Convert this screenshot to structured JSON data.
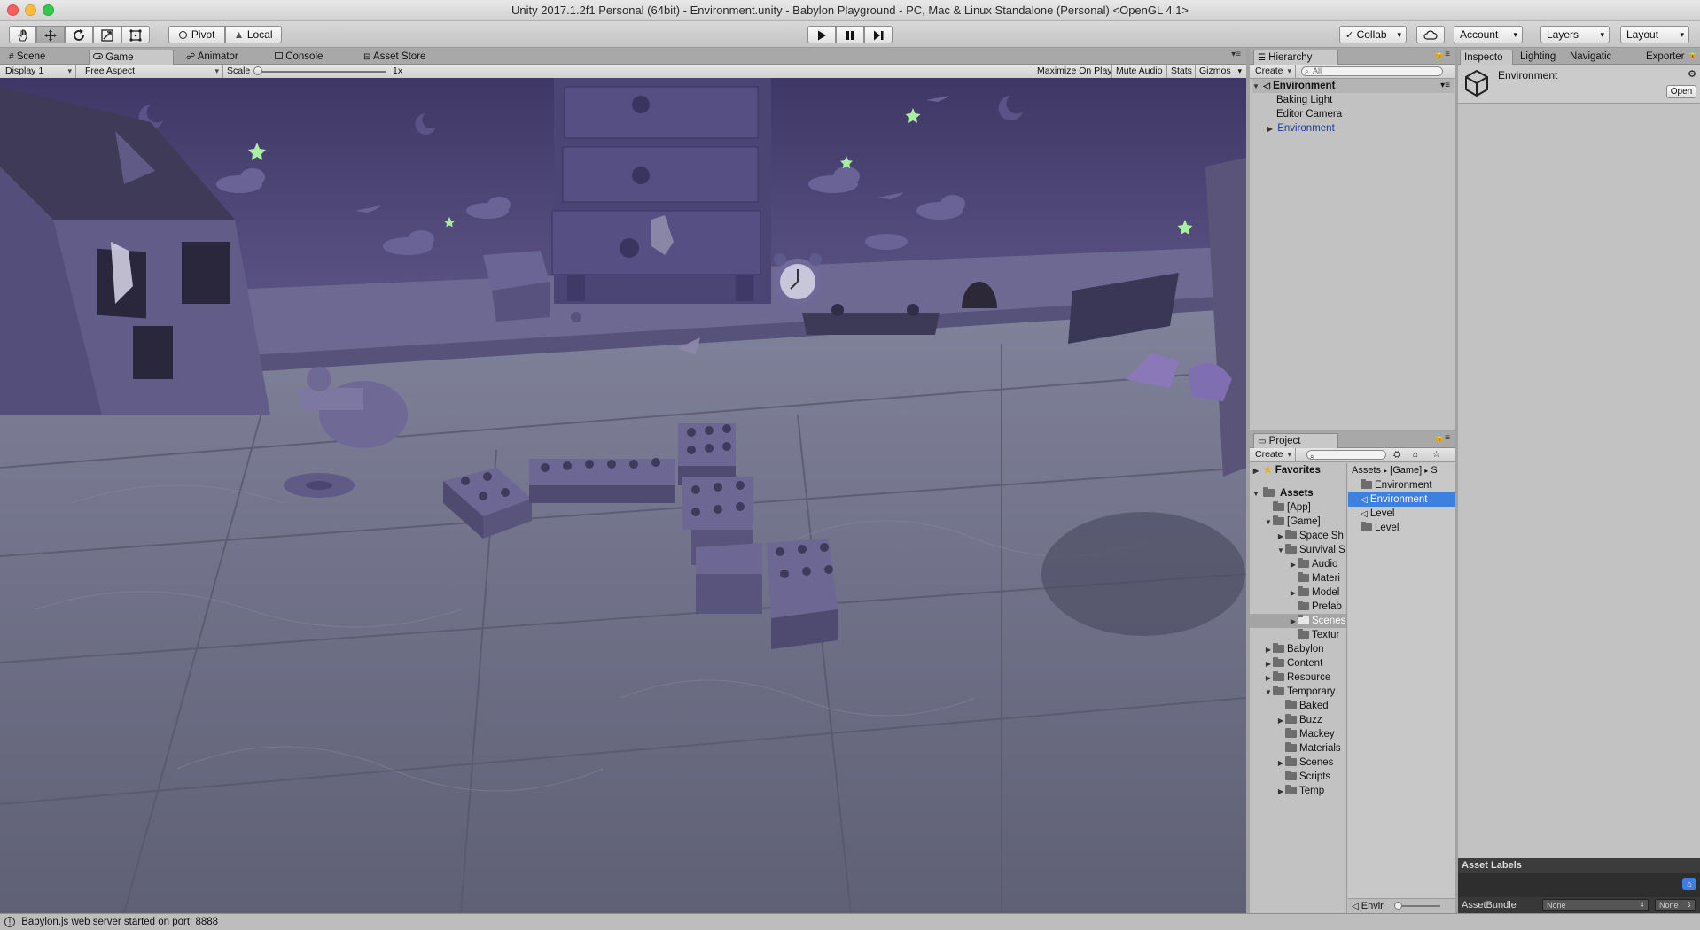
{
  "window": {
    "title": "Unity 2017.1.2f1 Personal (64bit) - Environment.unity - Babylon Playground - PC, Mac & Linux Standalone (Personal) <OpenGL 4.1>"
  },
  "toolbar": {
    "pivot_label": "Pivot",
    "local_label": "Local",
    "collab_label": "Collab",
    "account_label": "Account",
    "layers_label": "Layers",
    "layout_label": "Layout"
  },
  "left_tabs": [
    {
      "label": "Scene"
    },
    {
      "label": "Game"
    },
    {
      "label": "Animator"
    },
    {
      "label": "Console"
    },
    {
      "label": "Asset Store"
    }
  ],
  "game_bar": {
    "display": "Display 1",
    "aspect": "Free Aspect",
    "scale_label": "Scale",
    "scale_value": "1x",
    "maximize": "Maximize On Play",
    "mute": "Mute Audio",
    "stats": "Stats",
    "gizmos": "Gizmos"
  },
  "hierarchy": {
    "tab": "Hierarchy",
    "create": "Create",
    "search_placeholder": "All",
    "scene": "Environment",
    "items": [
      {
        "label": "Baking Light"
      },
      {
        "label": "Editor Camera"
      },
      {
        "label": "Environment"
      }
    ]
  },
  "project": {
    "tab": "Project",
    "create": "Create",
    "favorites": "Favorites",
    "assets": "Assets",
    "tree": [
      {
        "label": "[App]"
      },
      {
        "label": "[Game]"
      },
      {
        "label": "Space Sh"
      },
      {
        "label": "Survival S"
      },
      {
        "label": "Audio"
      },
      {
        "label": "Materi"
      },
      {
        "label": "Model"
      },
      {
        "label": "Prefab"
      },
      {
        "label": "Scenes"
      },
      {
        "label": "Textur"
      },
      {
        "label": "Babylon"
      },
      {
        "label": "Content"
      },
      {
        "label": "Resource"
      },
      {
        "label": "Temporary"
      },
      {
        "label": "Baked"
      },
      {
        "label": "Buzz"
      },
      {
        "label": "Mackey"
      },
      {
        "label": "Materials"
      },
      {
        "label": "Scenes"
      },
      {
        "label": "Scripts"
      },
      {
        "label": "Temp"
      }
    ],
    "breadcrumb": [
      "Assets",
      "[Game]",
      "S"
    ],
    "files": [
      {
        "label": "Environment"
      },
      {
        "label": "Environment"
      },
      {
        "label": "Level"
      },
      {
        "label": "Level"
      }
    ],
    "footer_item": "Envir"
  },
  "inspector": {
    "tabs": [
      {
        "label": "Inspecto"
      },
      {
        "label": "Lighting"
      },
      {
        "label": "Navigatic"
      },
      {
        "label": "Exporter"
      }
    ],
    "object_name": "Environment",
    "open_button": "Open",
    "asset_labels": "Asset Labels",
    "asset_bundle": "AssetBundle",
    "bundle_value": "None",
    "bundle_variant": "None"
  },
  "status": {
    "message": "Babylon.js web server started on port: 8888"
  },
  "colors": {
    "selection": "#3d80df",
    "link_blue": "#1a3a9c",
    "wall": "#4b4470",
    "floor": "#7c7d92"
  }
}
